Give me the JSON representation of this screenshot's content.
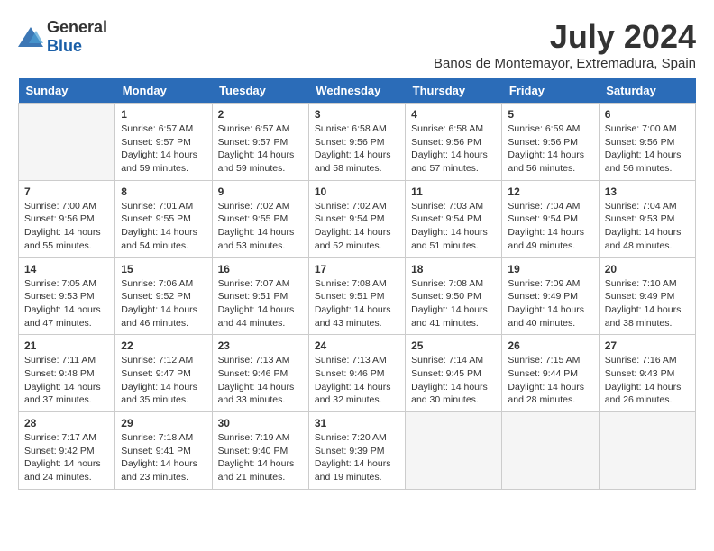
{
  "header": {
    "logo_general": "General",
    "logo_blue": "Blue",
    "month_title": "July 2024",
    "location": "Banos de Montemayor, Extremadura, Spain"
  },
  "columns": [
    "Sunday",
    "Monday",
    "Tuesday",
    "Wednesday",
    "Thursday",
    "Friday",
    "Saturday"
  ],
  "weeks": [
    [
      {
        "day": "",
        "info": ""
      },
      {
        "day": "1",
        "info": "Sunrise: 6:57 AM\nSunset: 9:57 PM\nDaylight: 14 hours\nand 59 minutes."
      },
      {
        "day": "2",
        "info": "Sunrise: 6:57 AM\nSunset: 9:57 PM\nDaylight: 14 hours\nand 59 minutes."
      },
      {
        "day": "3",
        "info": "Sunrise: 6:58 AM\nSunset: 9:56 PM\nDaylight: 14 hours\nand 58 minutes."
      },
      {
        "day": "4",
        "info": "Sunrise: 6:58 AM\nSunset: 9:56 PM\nDaylight: 14 hours\nand 57 minutes."
      },
      {
        "day": "5",
        "info": "Sunrise: 6:59 AM\nSunset: 9:56 PM\nDaylight: 14 hours\nand 56 minutes."
      },
      {
        "day": "6",
        "info": "Sunrise: 7:00 AM\nSunset: 9:56 PM\nDaylight: 14 hours\nand 56 minutes."
      }
    ],
    [
      {
        "day": "7",
        "info": "Sunrise: 7:00 AM\nSunset: 9:56 PM\nDaylight: 14 hours\nand 55 minutes."
      },
      {
        "day": "8",
        "info": "Sunrise: 7:01 AM\nSunset: 9:55 PM\nDaylight: 14 hours\nand 54 minutes."
      },
      {
        "day": "9",
        "info": "Sunrise: 7:02 AM\nSunset: 9:55 PM\nDaylight: 14 hours\nand 53 minutes."
      },
      {
        "day": "10",
        "info": "Sunrise: 7:02 AM\nSunset: 9:54 PM\nDaylight: 14 hours\nand 52 minutes."
      },
      {
        "day": "11",
        "info": "Sunrise: 7:03 AM\nSunset: 9:54 PM\nDaylight: 14 hours\nand 51 minutes."
      },
      {
        "day": "12",
        "info": "Sunrise: 7:04 AM\nSunset: 9:54 PM\nDaylight: 14 hours\nand 49 minutes."
      },
      {
        "day": "13",
        "info": "Sunrise: 7:04 AM\nSunset: 9:53 PM\nDaylight: 14 hours\nand 48 minutes."
      }
    ],
    [
      {
        "day": "14",
        "info": "Sunrise: 7:05 AM\nSunset: 9:53 PM\nDaylight: 14 hours\nand 47 minutes."
      },
      {
        "day": "15",
        "info": "Sunrise: 7:06 AM\nSunset: 9:52 PM\nDaylight: 14 hours\nand 46 minutes."
      },
      {
        "day": "16",
        "info": "Sunrise: 7:07 AM\nSunset: 9:51 PM\nDaylight: 14 hours\nand 44 minutes."
      },
      {
        "day": "17",
        "info": "Sunrise: 7:08 AM\nSunset: 9:51 PM\nDaylight: 14 hours\nand 43 minutes."
      },
      {
        "day": "18",
        "info": "Sunrise: 7:08 AM\nSunset: 9:50 PM\nDaylight: 14 hours\nand 41 minutes."
      },
      {
        "day": "19",
        "info": "Sunrise: 7:09 AM\nSunset: 9:49 PM\nDaylight: 14 hours\nand 40 minutes."
      },
      {
        "day": "20",
        "info": "Sunrise: 7:10 AM\nSunset: 9:49 PM\nDaylight: 14 hours\nand 38 minutes."
      }
    ],
    [
      {
        "day": "21",
        "info": "Sunrise: 7:11 AM\nSunset: 9:48 PM\nDaylight: 14 hours\nand 37 minutes."
      },
      {
        "day": "22",
        "info": "Sunrise: 7:12 AM\nSunset: 9:47 PM\nDaylight: 14 hours\nand 35 minutes."
      },
      {
        "day": "23",
        "info": "Sunrise: 7:13 AM\nSunset: 9:46 PM\nDaylight: 14 hours\nand 33 minutes."
      },
      {
        "day": "24",
        "info": "Sunrise: 7:13 AM\nSunset: 9:46 PM\nDaylight: 14 hours\nand 32 minutes."
      },
      {
        "day": "25",
        "info": "Sunrise: 7:14 AM\nSunset: 9:45 PM\nDaylight: 14 hours\nand 30 minutes."
      },
      {
        "day": "26",
        "info": "Sunrise: 7:15 AM\nSunset: 9:44 PM\nDaylight: 14 hours\nand 28 minutes."
      },
      {
        "day": "27",
        "info": "Sunrise: 7:16 AM\nSunset: 9:43 PM\nDaylight: 14 hours\nand 26 minutes."
      }
    ],
    [
      {
        "day": "28",
        "info": "Sunrise: 7:17 AM\nSunset: 9:42 PM\nDaylight: 14 hours\nand 24 minutes."
      },
      {
        "day": "29",
        "info": "Sunrise: 7:18 AM\nSunset: 9:41 PM\nDaylight: 14 hours\nand 23 minutes."
      },
      {
        "day": "30",
        "info": "Sunrise: 7:19 AM\nSunset: 9:40 PM\nDaylight: 14 hours\nand 21 minutes."
      },
      {
        "day": "31",
        "info": "Sunrise: 7:20 AM\nSunset: 9:39 PM\nDaylight: 14 hours\nand 19 minutes."
      },
      {
        "day": "",
        "info": ""
      },
      {
        "day": "",
        "info": ""
      },
      {
        "day": "",
        "info": ""
      }
    ]
  ]
}
